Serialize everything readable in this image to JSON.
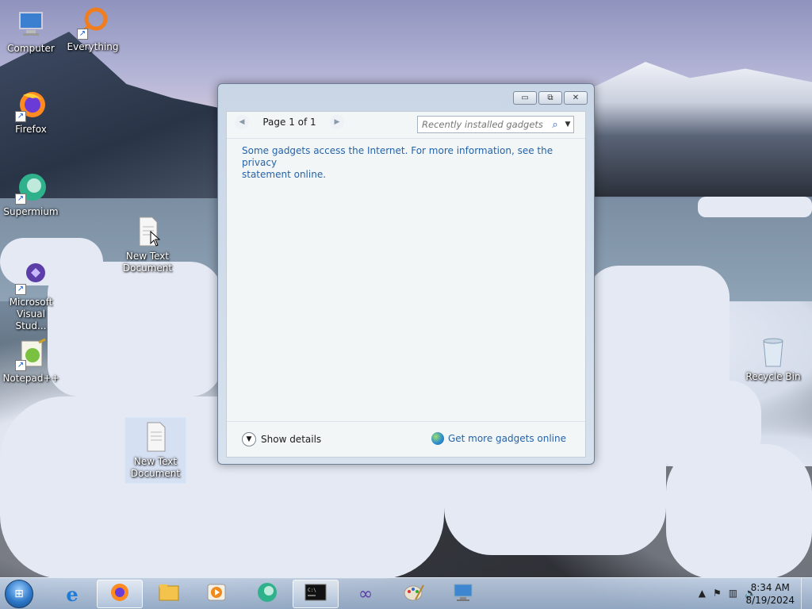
{
  "desktop": {
    "icons": [
      {
        "label": "Computer"
      },
      {
        "label": "Everything"
      },
      {
        "label": "Firefox"
      },
      {
        "label": "Supermium"
      },
      {
        "label": "New Text Document"
      },
      {
        "label": "Microsoft Visual Stud..."
      },
      {
        "label": "Notepad++"
      },
      {
        "label": "New Text Document"
      },
      {
        "label": "Recycle Bin"
      }
    ]
  },
  "gadget_window": {
    "pager": {
      "prev_icon": "chevron-left-icon",
      "label": "Page 1 of 1",
      "next_icon": "chevron-right-icon"
    },
    "search": {
      "placeholder": "Recently installed gadgets"
    },
    "notice_line1": "Some gadgets access the Internet.  For more information, see the privacy",
    "notice_line2": "statement online.",
    "show_details": "Show details",
    "get_more": "Get more gadgets online"
  },
  "taskbar": {
    "clock_time": "8:34 AM",
    "clock_date": "8/19/2024",
    "items": [
      "internet-explorer-icon",
      "firefox-icon",
      "file-explorer-icon",
      "media-player-icon",
      "supermium-icon",
      "command-prompt-icon",
      "visual-studio-icon",
      "paint-icon",
      "remote-desktop-icon"
    ]
  }
}
